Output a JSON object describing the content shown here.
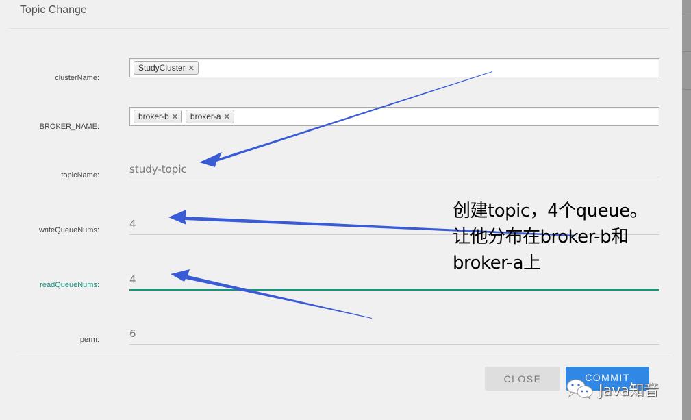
{
  "dialog": {
    "title": "Topic Change"
  },
  "form": {
    "cluster_name": {
      "label": "clusterName:",
      "tags": [
        "StudyCluster"
      ]
    },
    "broker_name": {
      "label": "BROKER_NAME:",
      "tags": [
        "broker-b",
        "broker-a"
      ]
    },
    "topic_name": {
      "label": "topicName:",
      "value": "study-topic"
    },
    "write_queue_nums": {
      "label": "writeQueueNums:",
      "value": "4"
    },
    "read_queue_nums": {
      "label": "readQueueNums:",
      "value": "4",
      "focused": true
    },
    "perm": {
      "label": "perm:",
      "value": "6"
    },
    "tag_remove_symbol": "✕"
  },
  "buttons": {
    "close_label": "CLOSE",
    "commit_label": "COMMIT"
  },
  "annotation": {
    "lines": [
      "创建topic，4个queue。",
      "让他分布在broker-b和",
      "broker-a上"
    ],
    "arrow_color": "#3a5bd6"
  },
  "watermark": {
    "icon": "wechat-icon",
    "text": "Java知音"
  },
  "colors": {
    "accent_focus": "#14957e",
    "primary_button": "#3188e4",
    "secondary_button": "#dedede"
  }
}
